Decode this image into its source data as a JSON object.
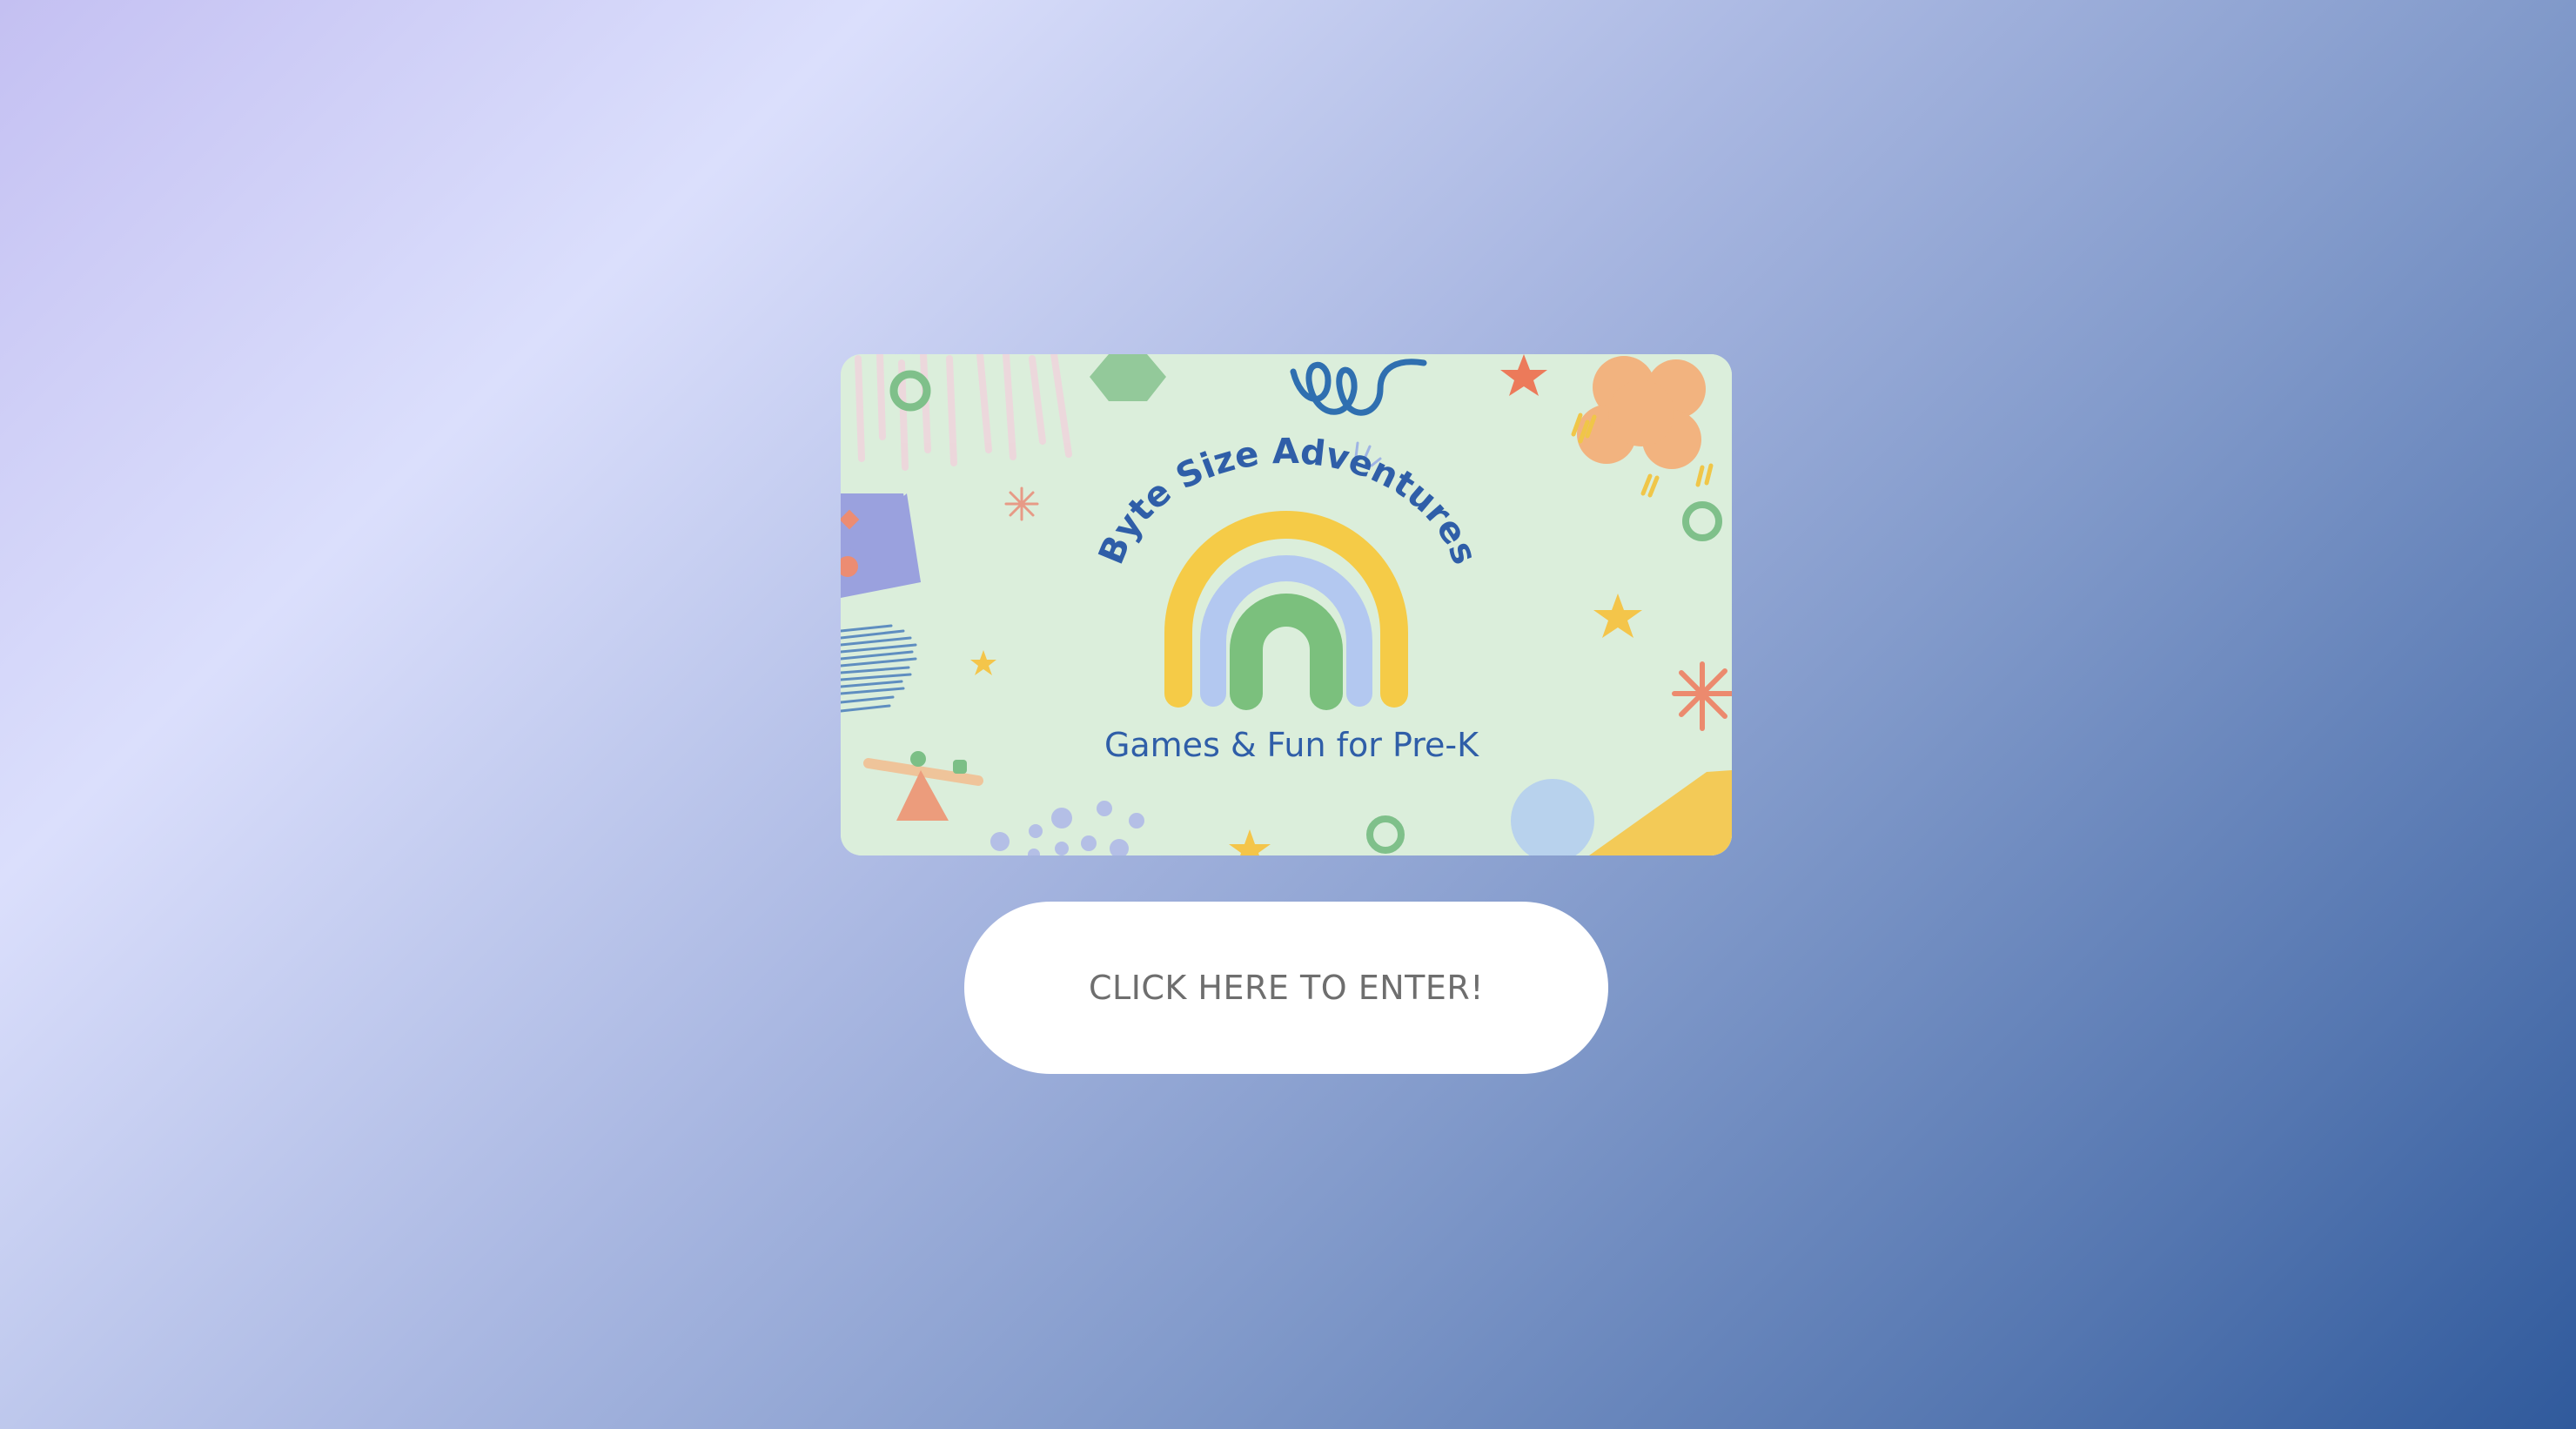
{
  "banner": {
    "title": "Byte Size Adventures",
    "subtitle": "Games & Fun for Pre-K",
    "colors": {
      "background": "#dbeedb",
      "title": "#2f5ea8",
      "rainbow_outer": "#f5cb47",
      "rainbow_middle": "#b3c8f0",
      "rainbow_inner": "#7bc07d"
    }
  },
  "enter_button": {
    "label": "CLICK HERE TO ENTER!",
    "text_color": "#6e6e6e",
    "background": "#ffffff"
  }
}
